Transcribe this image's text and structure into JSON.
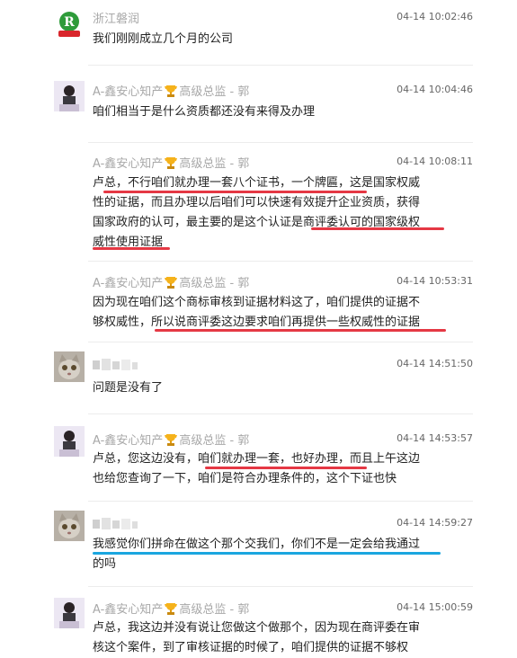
{
  "messages": [
    {
      "sender": "浙江磐润",
      "time": "04-14 10:02:46",
      "lines": [
        "我们刚刚成立几个月的公司"
      ]
    },
    {
      "sender": "A-鑫安心知产",
      "title": "高级总监 - 郭",
      "time": "04-14 10:04:46",
      "lines": [
        "咱们相当于是什么资质都还没有来得及办理"
      ]
    },
    {
      "sender": "A-鑫安心知产",
      "title": "高级总监 - 郭",
      "time": "04-14 10:08:11",
      "lines": [
        "卢总，不行咱们就办理一套八个证书，一个牌匾，这是国家权威",
        "性的证据，而且办理以后咱们可以快速有效提升企业资质，获得",
        "国家政府的认可，最主要的是这个认证是商评委认可的国家级权",
        "威性使用证据"
      ]
    },
    {
      "sender": "A-鑫安心知产",
      "title": "高级总监 - 郭",
      "time": "04-14 10:53:31",
      "lines": [
        "因为现在咱们这个商标审核到证据材料这了，咱们提供的证据不",
        "够权威性，所以说商评委这边要求咱们再提供一些权威性的证据"
      ]
    },
    {
      "sender": "",
      "time": "04-14 14:51:50",
      "lines": [
        "问题是没有了"
      ]
    },
    {
      "sender": "A-鑫安心知产",
      "title": "高级总监 - 郭",
      "time": "04-14 14:53:57",
      "lines": [
        "卢总，您这边没有，咱们就办理一套，也好办理，而且上午这边",
        "也给您查询了一下，咱们是符合办理条件的，这个下证也快"
      ]
    },
    {
      "sender": "",
      "time": "04-14 14:59:27",
      "lines": [
        "我感觉你们拼命在做这个那个交我们，你们不是一定会给我通过",
        "的吗"
      ]
    },
    {
      "sender": "A-鑫安心知产",
      "title": "高级总监 - 郭",
      "time": "04-14 15:00:59",
      "lines": [
        "卢总，我这边并没有说让您做这个做那个，因为现在商评委在审",
        "核这个案件，到了审核证据的时候了，咱们提供的证据不够权"
      ]
    }
  ],
  "colors": {
    "name": "#a8a8a8",
    "underline_red": "#e53844",
    "underline_blue": "#1aa6df",
    "logo_green": "#2e9b3a",
    "logo_red": "#d9262c"
  },
  "icons": {
    "trophy": "trophy-icon"
  }
}
